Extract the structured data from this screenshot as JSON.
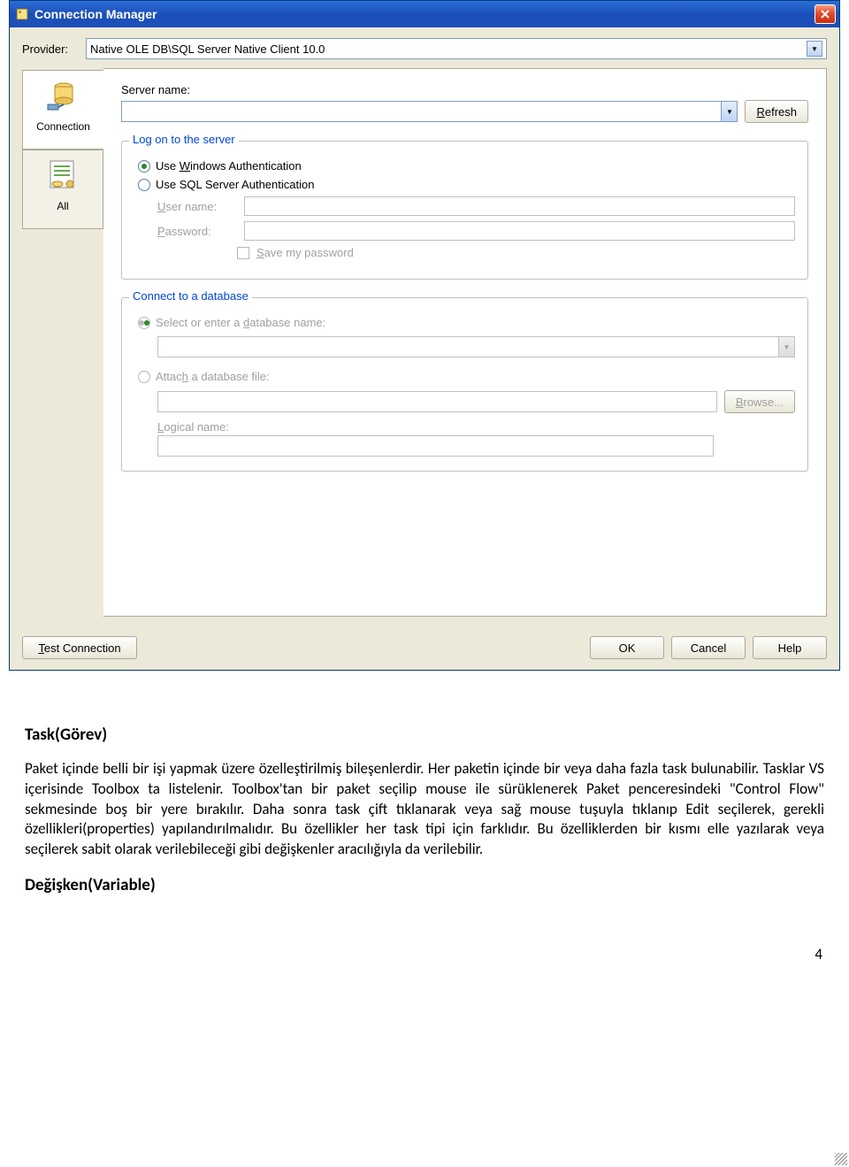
{
  "titlebar": {
    "title": "Connection Manager"
  },
  "provider": {
    "label": "Provider:",
    "value": "Native OLE DB\\SQL Server Native Client 10.0"
  },
  "tabs": {
    "connection": "Connection",
    "all": "All"
  },
  "server": {
    "label": "Server name:",
    "value": "",
    "refresh": "Refresh"
  },
  "logon": {
    "legend": "Log on to the server",
    "opt_windows": "Use Windows Authentication",
    "opt_sql": "Use SQL Server Authentication",
    "user_label": "User name:",
    "pass_label": "Password:",
    "save_pw": "Save my password"
  },
  "connectdb": {
    "legend": "Connect to a database",
    "opt_select": "Select or enter a database name:",
    "opt_attach": "Attach a database file:",
    "browse": "Browse...",
    "logical_label": "Logical name:"
  },
  "footer": {
    "test": "Test Connection",
    "ok": "OK",
    "cancel": "Cancel",
    "help": "Help"
  },
  "doc": {
    "h_task": "Task(Görev)",
    "p_task": "Paket içinde belli bir işi yapmak üzere özelleştirilmiş bileşenlerdir. Her paketin içinde bir veya daha fazla task  bulunabilir. Tasklar VS içerisinde Toolbox ta listelenir. Toolbox'tan bir paket seçilip mouse ile sürüklenerek Paket penceresindeki \"Control Flow\" sekmesinde boş bir yere bırakılır. Daha sonra task çift tıklanarak veya sağ mouse tuşuyla tıklanıp Edit seçilerek, gerekli özellikleri(properties) yapılandırılmalıdır. Bu özellikler her task tipi için farklıdır. Bu özelliklerden bir kısmı elle yazılarak veya seçilerek sabit olarak verilebileceği gibi değişkenler aracılığıyla da verilebilir.",
    "h_var": "Değişken(Variable)",
    "page_num": "4"
  }
}
